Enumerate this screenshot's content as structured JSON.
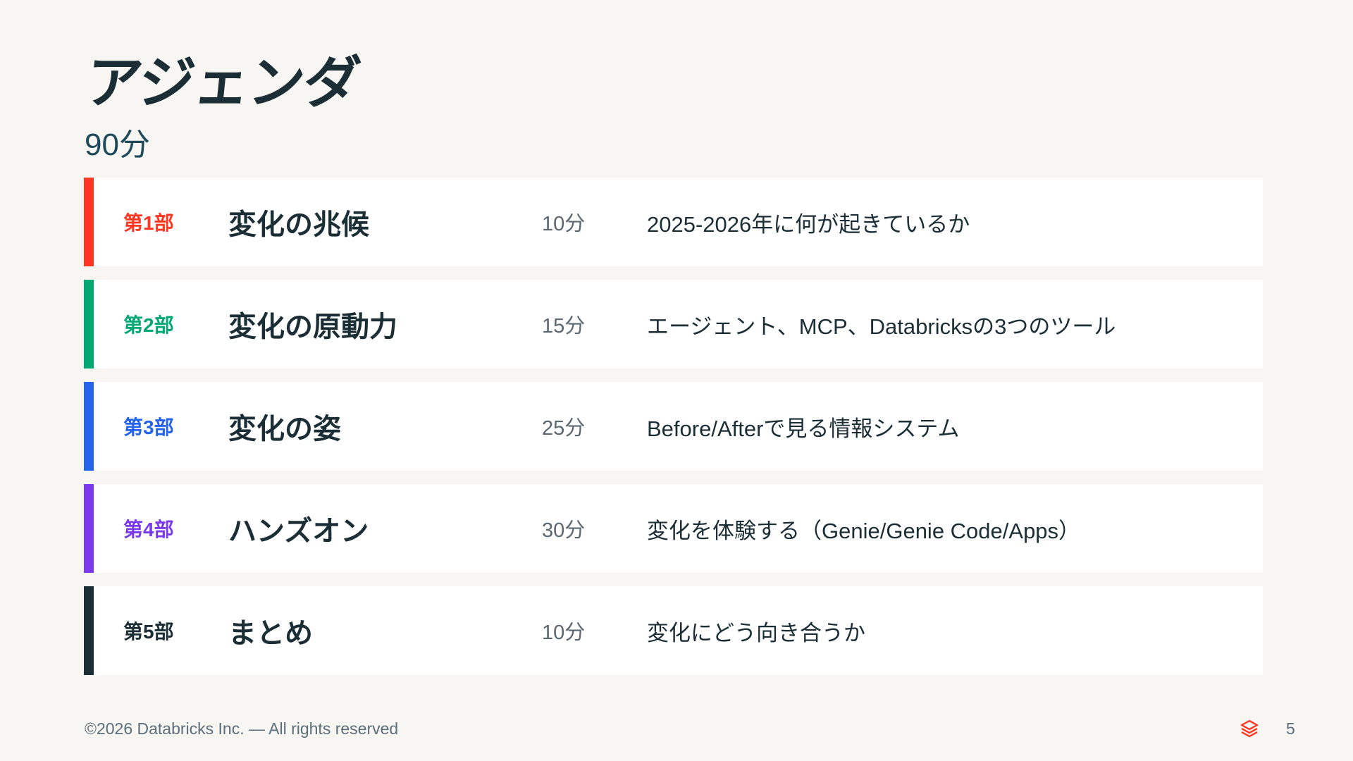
{
  "slide": {
    "title": "アジェンダ",
    "subtitle": "90分"
  },
  "agenda": [
    {
      "part": "第1部",
      "name": "変化の兆候",
      "duration": "10分",
      "description": "2025-2026年に何が起きているか",
      "color": "#ff3621"
    },
    {
      "part": "第2部",
      "name": "変化の原動力",
      "duration": "15分",
      "description": "エージェント、MCP、Databricksの3つのツール",
      "color": "#00a972"
    },
    {
      "part": "第3部",
      "name": "変化の姿",
      "duration": "25分",
      "description": "Before/Afterで見る情報システム",
      "color": "#2563eb"
    },
    {
      "part": "第4部",
      "name": "ハンズオン",
      "duration": "30分",
      "description": "変化を体験する（Genie/Genie Code/Apps）",
      "color": "#7c3aed"
    },
    {
      "part": "第5部",
      "name": "まとめ",
      "duration": "10分",
      "description": "変化にどう向き合うか",
      "color": "#1b2e36"
    }
  ],
  "footer": {
    "copyright": "©2026 Databricks Inc. — All rights reserved",
    "logo_icon": "databricks-logo-icon",
    "logo_color": "#ff3621",
    "page_number": "5"
  }
}
